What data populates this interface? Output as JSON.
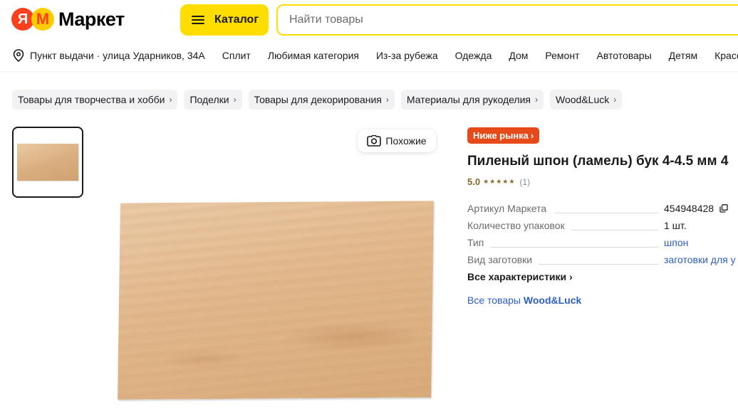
{
  "header": {
    "logo_letter": "Я",
    "logo_text": "Маркет",
    "catalog_label": "Каталог",
    "search_placeholder": "Найти товары"
  },
  "nav": {
    "pickup": "Пункт выдачи · улица Ударников, 34А",
    "items": [
      "Сплит",
      "Любимая категория",
      "Из-за рубежа",
      "Одежда",
      "Дом",
      "Ремонт",
      "Автотовары",
      "Детям",
      "Красота"
    ]
  },
  "breadcrumbs": [
    "Товары для творчества и хобби",
    "Поделки",
    "Товары для декорирования",
    "Материалы для рукоделия",
    "Wood&Luck"
  ],
  "gallery": {
    "similar_label": "Похожие"
  },
  "product": {
    "badge": "Ниже рынка",
    "title": "Пиленый шпон (ламель) бук 4-4.5 мм 4",
    "rating": "5.0",
    "stars": "★★★★★",
    "reviews": "(1)",
    "specs": [
      {
        "label": "Артикул Маркета",
        "value": "454948428"
      },
      {
        "label": "Количество упаковок",
        "value": "1 шт."
      },
      {
        "label": "Тип",
        "value": "шпон"
      },
      {
        "label": "Вид заготовки",
        "value": "заготовки для у"
      }
    ],
    "all_characteristics": "Все характеристики",
    "all_goods_prefix": "Все товары",
    "brand": "Wood&Luck"
  },
  "colors": {
    "accent_yellow": "#ffdd00",
    "badge_red": "#e64a19",
    "link_blue": "#2d5ec4",
    "rating_gold": "#8a6a28"
  }
}
